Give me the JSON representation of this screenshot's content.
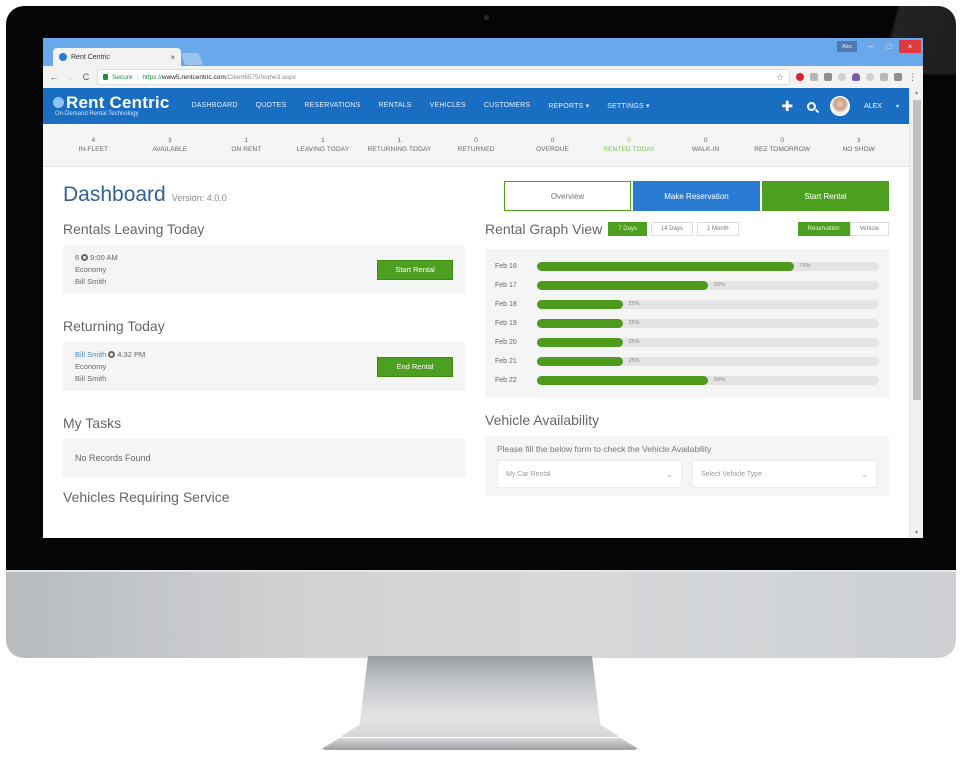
{
  "browser": {
    "tab_title": "Rent Centric",
    "tab_close": "×",
    "profile_badge": "Alex",
    "min_glyph": "–",
    "max_glyph": "□",
    "close_glyph": "×",
    "back_glyph": "←",
    "forward_glyph": "→",
    "reload_glyph": "C",
    "secure_label": "Secure",
    "separator": "|",
    "url_scheme": "https://",
    "url_host": "www5.rentcentric.com",
    "url_path": "/Client6575/home3.aspx",
    "star_glyph": "☆",
    "menu_glyph": "⋮"
  },
  "app": {
    "logo_text": "Rent Centric",
    "logo_tagline": "On-Demand Rental Technology",
    "nav": [
      {
        "label": "DASHBOARD"
      },
      {
        "label": "QUOTES"
      },
      {
        "label": "RESERVATIONS"
      },
      {
        "label": "RENTALS"
      },
      {
        "label": "VEHICLES"
      },
      {
        "label": "CUSTOMERS"
      },
      {
        "label": "REPORTS ▾"
      },
      {
        "label": "SETTINGS ▾"
      }
    ],
    "plus_glyph": "✚",
    "user_name": "ALEX",
    "user_caret": "▾"
  },
  "stats": [
    {
      "value": "4",
      "label": "IN-FLEET"
    },
    {
      "value": "3",
      "label": "AVAILABLE"
    },
    {
      "value": "1",
      "label": "ON RENT"
    },
    {
      "value": "1",
      "label": "LEAVING TODAY"
    },
    {
      "value": "1",
      "label": "RETURNING TODAY"
    },
    {
      "value": "0",
      "label": "RETURNED"
    },
    {
      "value": "0",
      "label": "OVERDUE"
    },
    {
      "value": "0",
      "label": "RENTED TODAY",
      "highlight": true
    },
    {
      "value": "0",
      "label": "WALK-IN"
    },
    {
      "value": "0",
      "label": "REZ TOMORROW"
    },
    {
      "value": "3",
      "label": "NO SHOW"
    }
  ],
  "colors": {
    "brand_blue": "#1a6ec2",
    "action_green": "#4da01f",
    "action_blue": "#2a7bd2",
    "title_blue": "#34608f",
    "highlight_green": "#7bbf52"
  },
  "dashboard": {
    "title": "Dashboard",
    "version": "Version: 4.0.0",
    "leaving": {
      "title": "Rentals Leaving Today",
      "item": {
        "prefix": "6",
        "time": "9:00 AM",
        "class": "Economy",
        "customer": "Bill Smith"
      },
      "button": "Start Rental"
    },
    "returning": {
      "title": "Returning Today",
      "item": {
        "name_link": "Bill Smith",
        "time": "4:32 PM",
        "class": "Economy",
        "customer": "Bill Smith"
      },
      "button": "End Rental"
    },
    "tasks": {
      "title": "My Tasks",
      "empty": "No Records Found"
    },
    "service": {
      "title": "Vehicles Requiring Service"
    },
    "actions": {
      "overview": "Overview",
      "make_reservation": "Make Reservation",
      "start_rental": "Start Rental"
    },
    "graph": {
      "title": "Rental Graph View",
      "ranges": [
        {
          "label": "7 Days",
          "active": true
        },
        {
          "label": "14 Days"
        },
        {
          "label": "1 Month"
        }
      ],
      "modes": [
        {
          "label": "Reservation",
          "active": true
        },
        {
          "label": "Vehicle"
        }
      ]
    },
    "availability": {
      "title": "Vehicle Availability",
      "instructions": "Please fill the below form to check the Vehicle Availability",
      "location_select": "My Car Rental",
      "type_select": "Select Vehicle Type"
    }
  },
  "chart_data": {
    "type": "bar",
    "orientation": "horizontal",
    "title": "Rental Graph View",
    "categories": [
      "Feb 16",
      "Feb 17",
      "Feb 18",
      "Feb 19",
      "Feb 20",
      "Feb 21",
      "Feb 22"
    ],
    "values": [
      75,
      50,
      25,
      25,
      25,
      25,
      50
    ],
    "value_labels": [
      "75%",
      "50%",
      "25%",
      "25%",
      "25%",
      "25%",
      "50%"
    ],
    "xlim": [
      0,
      100
    ],
    "unit": "%"
  }
}
